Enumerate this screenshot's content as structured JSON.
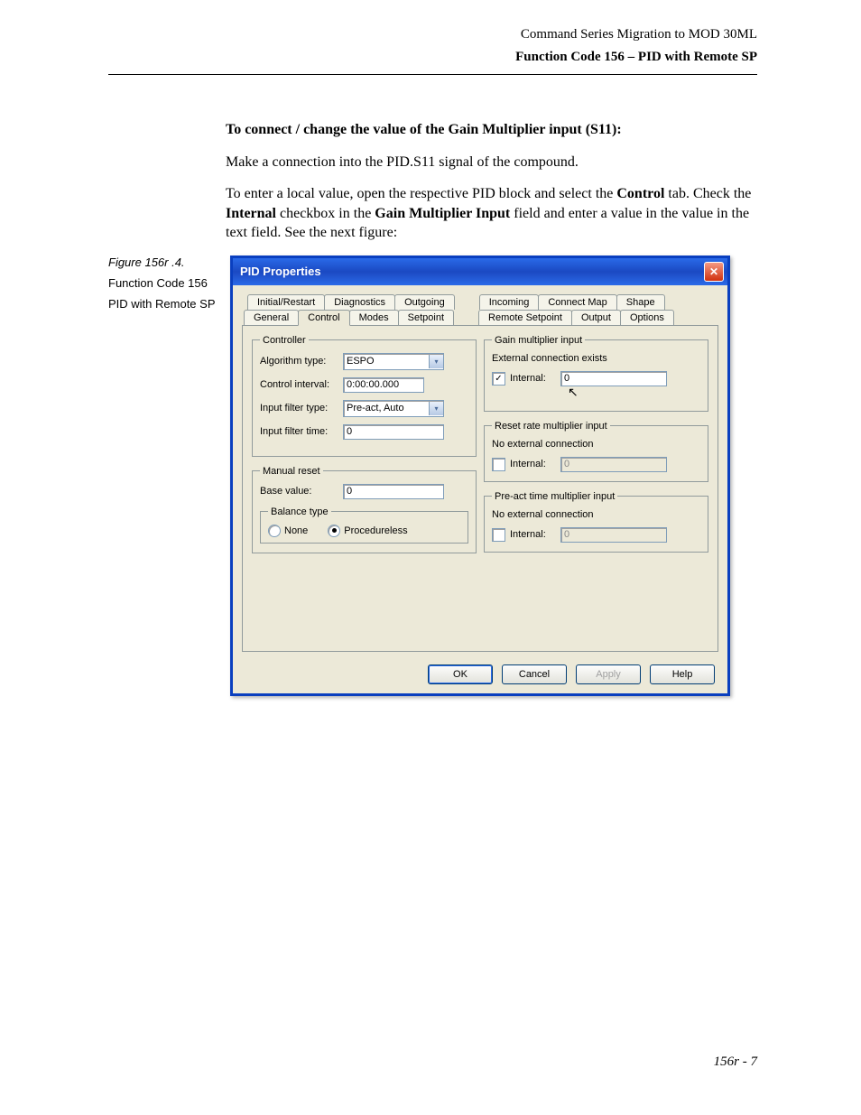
{
  "header": {
    "top": "Command Series Migration to MOD 30ML",
    "sub": "Function Code 156 – PID with Remote SP"
  },
  "body": {
    "heading": "To connect / change the value of the Gain Multiplier input (S11):",
    "p1": "Make a connection into the PID.S11 signal of the compound.",
    "p2_pre": "To enter a local value, open the respective PID block and select the ",
    "p2_control": "Control",
    "p2_mid1": " tab. Check the ",
    "p2_internal": "Internal",
    "p2_mid2": " checkbox in the ",
    "p2_gain": "Gain Multiplier Input",
    "p2_post": " field and enter a value in the  value in the text field. See the next figure:"
  },
  "aside": {
    "fig": "Figure 156r .4.",
    "line1": "Function Code 156",
    "line2": "PID with Remote SP"
  },
  "dialog": {
    "title": "PID Properties",
    "tabs_back": [
      "Initial/Restart",
      "Diagnostics",
      "Outgoing",
      "",
      "Incoming",
      "Connect Map",
      "Shape"
    ],
    "tabs_front": [
      "General",
      "Control",
      "Modes",
      "Setpoint",
      "",
      "Remote Setpoint",
      "Output",
      "Options"
    ],
    "selected_tab": "Control",
    "controller": {
      "legend": "Controller",
      "algo_label": "Algorithm type:",
      "algo_value": "ESPO",
      "interval_label": "Control interval:",
      "interval_value": "0:00:00.000",
      "filter_type_label": "Input filter type:",
      "filter_type_value": "Pre-act, Auto",
      "filter_time_label": "Input filter time:",
      "filter_time_value": "0"
    },
    "manual_reset": {
      "legend": "Manual reset",
      "base_label": "Base value:",
      "base_value": "0",
      "balance_legend": "Balance type",
      "opt_none": "None",
      "opt_proc": "Procedureless",
      "selected": "Procedureless"
    },
    "gain": {
      "legend": "Gain multiplier input",
      "status": "External connection exists",
      "internal_label": "Internal:",
      "internal_checked": true,
      "internal_value": "0"
    },
    "reset": {
      "legend": "Reset rate multiplier input",
      "status": "No external connection",
      "internal_label": "Internal:",
      "internal_checked": false,
      "internal_value": "0"
    },
    "preact": {
      "legend": "Pre-act time multiplier input",
      "status": "No external connection",
      "internal_label": "Internal:",
      "internal_checked": false,
      "internal_value": "0"
    },
    "buttons": {
      "ok": "OK",
      "cancel": "Cancel",
      "apply": "Apply",
      "help": "Help"
    }
  },
  "footer": "156r - 7"
}
